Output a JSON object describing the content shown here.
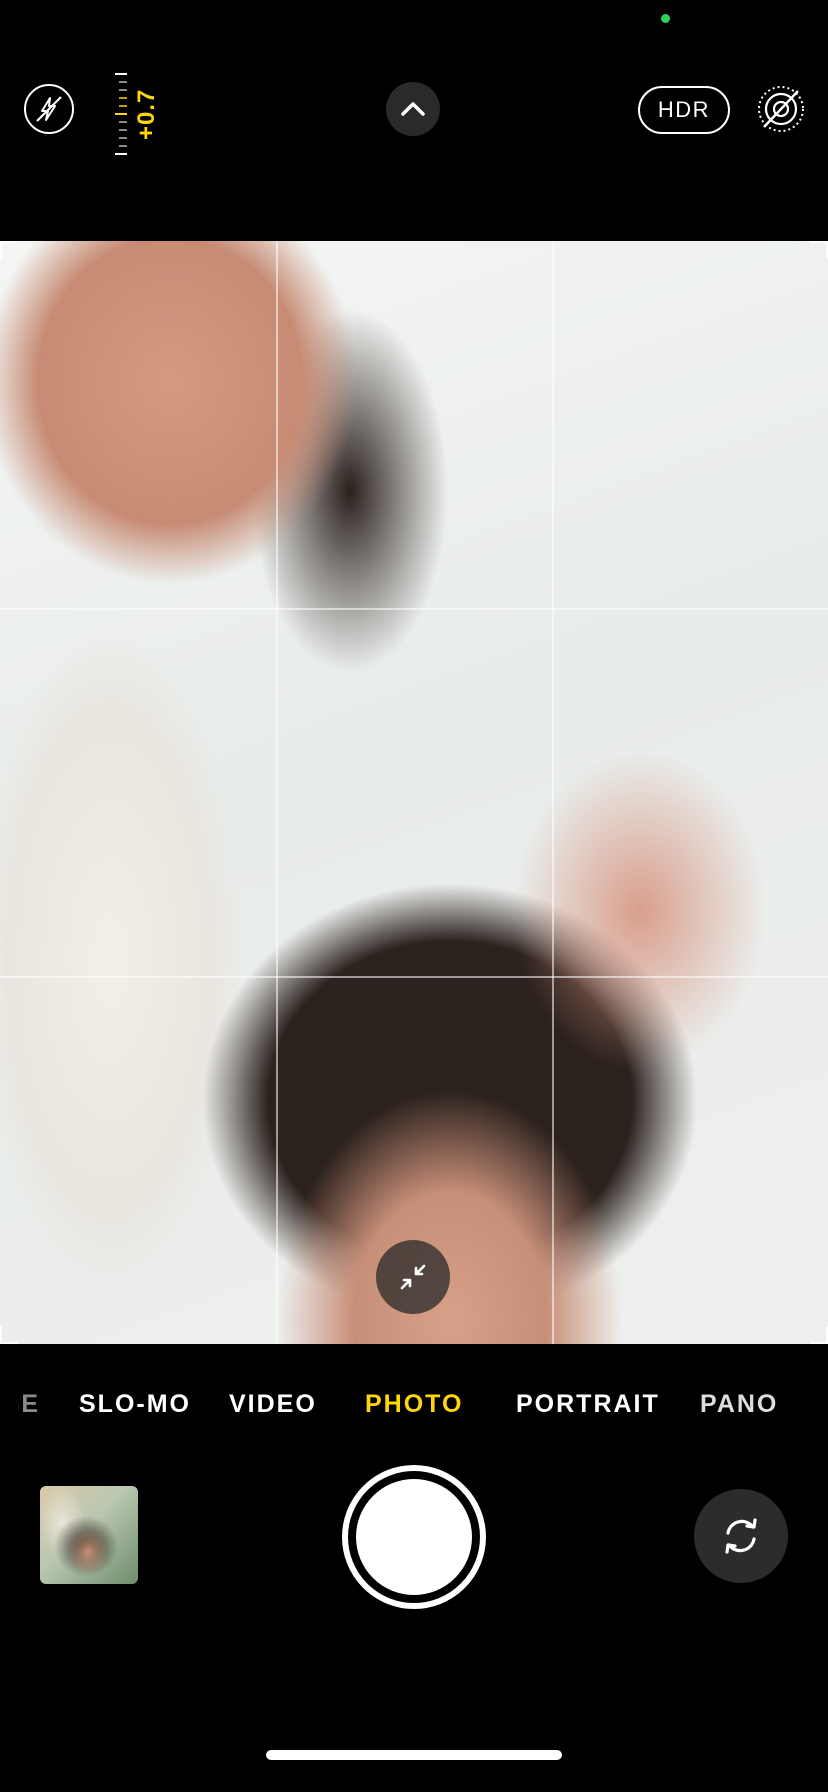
{
  "status": {
    "privacy_indicator_color": "#2fd158"
  },
  "top_bar": {
    "flash_icon": "flash-off-icon",
    "exposure_value": "+0.7",
    "controls_toggle_icon": "chevron-up-icon",
    "hdr_label": "HDR",
    "live_photo_icon": "live-photo-off-icon"
  },
  "viewfinder": {
    "grid": true,
    "zoom_toggle_icon": "collapse-arrows-icon"
  },
  "modes": {
    "items": [
      "TIME-LAPSE",
      "SLO-MO",
      "VIDEO",
      "PHOTO",
      "PORTRAIT",
      "PANO"
    ],
    "selected": "PHOTO",
    "partial_label": "SE"
  },
  "bottom_bar": {
    "shutter_icon": "shutter-icon",
    "switch_camera_icon": "camera-flip-icon",
    "thumbnail": "last-photo-thumbnail"
  },
  "colors": {
    "accent": "#ffd60a",
    "background": "#000000"
  }
}
